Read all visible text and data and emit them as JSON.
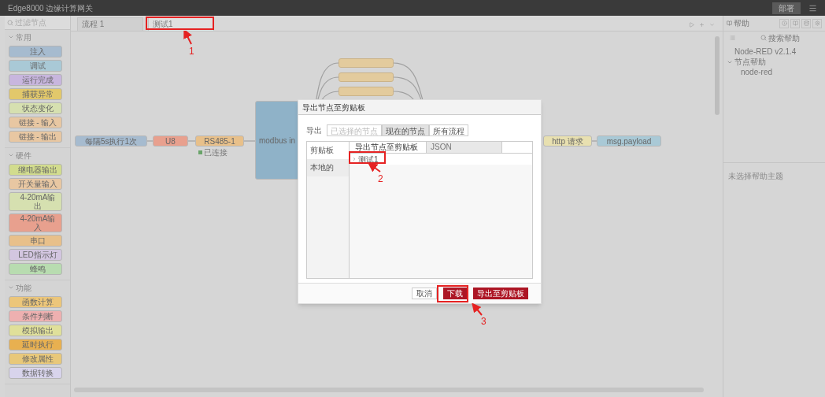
{
  "window": {
    "title": "Edge8000 边缘计算网关",
    "deploy": "部署"
  },
  "palette": {
    "search_placeholder": "过滤节点",
    "categories": [
      {
        "name": "常用",
        "expanded": true,
        "nodes": [
          {
            "label": "注入",
            "color": "#a6bbcf"
          },
          {
            "label": "调试",
            "color": "#a9c9d6"
          },
          {
            "label": "运行完成",
            "color": "#c8b6de"
          },
          {
            "label": "捕获异常",
            "color": "#e2c86b"
          },
          {
            "label": "状态变化",
            "color": "#d6e0b0"
          },
          {
            "label": "链接 - 输入",
            "color": "#e8c7a2"
          },
          {
            "label": "链接 - 输出",
            "color": "#e8c7a2"
          }
        ]
      },
      {
        "name": "硬件",
        "expanded": true,
        "nodes": [
          {
            "label": "继电器输出",
            "color": "#d2dc8e"
          },
          {
            "label": "开关量输入",
            "color": "#e8c7a2"
          },
          {
            "label": "4-20mA输出",
            "color": "#d6e0b0"
          },
          {
            "label": "4-20mA输入",
            "color": "#e8a08e"
          },
          {
            "label": "串口",
            "color": "#e8c08a"
          },
          {
            "label": "LED指示灯",
            "color": "#d3c6e0"
          },
          {
            "label": "蜂鸣",
            "color": "#b8dcb0"
          }
        ]
      },
      {
        "name": "功能",
        "expanded": true,
        "nodes": [
          {
            "label": "函数计算",
            "color": "#ecc67a"
          },
          {
            "label": "条件判断",
            "color": "#eeb0b0"
          },
          {
            "label": "模拟输出",
            "color": "#e0e09a"
          },
          {
            "label": "延时执行",
            "color": "#e8b050"
          },
          {
            "label": "修改属性",
            "color": "#e8c87a"
          },
          {
            "label": "数据转换",
            "color": "#d8d4ec"
          }
        ]
      }
    ]
  },
  "workspace": {
    "tabs": [
      {
        "label": "流程 1",
        "selected": false
      },
      {
        "label": "测试1",
        "selected": true
      }
    ],
    "nodes": [
      {
        "label": "每隔5s执行1次",
        "color": "#a6bbcf"
      },
      {
        "label": "U8",
        "color": "#e8a08e"
      },
      {
        "label": "RS485-1",
        "color": "#e8c08a",
        "status": "已连接"
      },
      {
        "label": "modbus in",
        "color": "#8fb2c8"
      },
      {
        "label": "http 请求",
        "color": "#e8e0b0"
      },
      {
        "label": "msg.payload",
        "color": "#a9c9d6"
      }
    ]
  },
  "dialog": {
    "title": "导出节点至剪贴板",
    "export_label": "导出",
    "scope": [
      {
        "label": "已选择的节点",
        "selected": false,
        "disabled": true
      },
      {
        "label": "现在的节点",
        "selected": true,
        "disabled": false
      },
      {
        "label": "所有流程",
        "selected": false,
        "disabled": false
      }
    ],
    "targets": [
      {
        "label": "剪贴板",
        "selected": true
      },
      {
        "label": "本地的",
        "selected": false
      }
    ],
    "tabs": [
      {
        "label": "导出节点至剪贴板",
        "selected": true
      },
      {
        "label": "JSON",
        "selected": false
      }
    ],
    "tree": [
      {
        "label": "测试1",
        "expanded": false
      }
    ],
    "buttons": [
      {
        "label": "取消",
        "kind": "plain"
      },
      {
        "label": "下载",
        "kind": "primary"
      },
      {
        "label": "导出至剪贴板",
        "kind": "primary"
      }
    ]
  },
  "sidebar": {
    "tab": "帮助",
    "search_placeholder": "搜索帮助",
    "tree": [
      {
        "label": "Node-RED v2.1.4"
      },
      {
        "label": "节点帮助",
        "expanded": true,
        "children": [
          {
            "label": "node-red"
          }
        ]
      }
    ],
    "empty_text": "未选择帮助主题"
  },
  "annotations": [
    {
      "number": "1"
    },
    {
      "number": "2"
    },
    {
      "number": "3"
    }
  ]
}
